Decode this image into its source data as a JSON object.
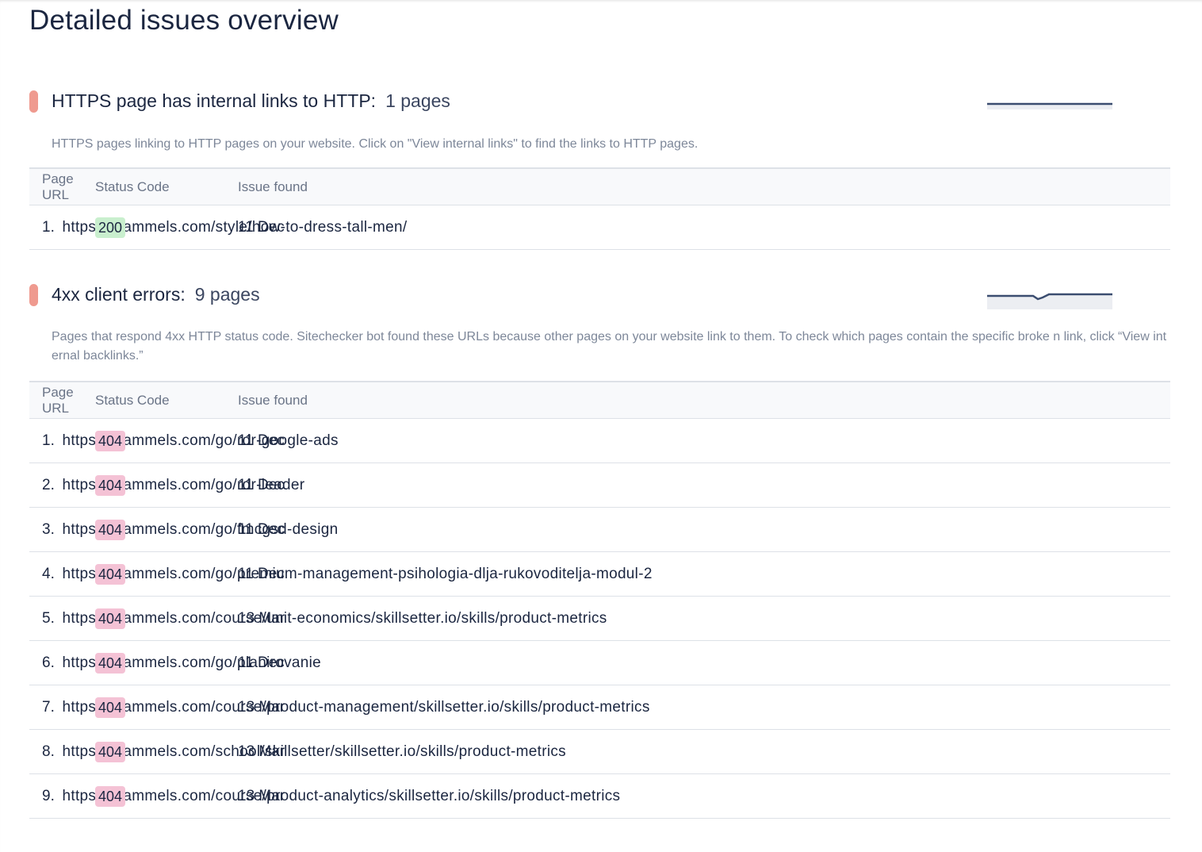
{
  "page": {
    "title": "Detailed issues overview"
  },
  "colors": {
    "marker": "#ef9a8f",
    "badge_ok": "#c9efce",
    "badge_error": "#f4c2d5",
    "sparkline": "#3b4d70"
  },
  "sections": [
    {
      "title": "HTTPS page has internal links to HTTP:",
      "count": "1 pages",
      "description": "HTTPS pages linking to HTTP pages on your website. Click on \"View internal links\" to find the links to HTTP pages.",
      "columns": [
        "Page URL",
        "Status Code",
        "Issue found"
      ],
      "rows": [
        {
          "num": "1.",
          "url": "https://brammels.com/style/how-to-dress-tall-men/",
          "status": "200",
          "date": "11 Dec"
        }
      ]
    },
    {
      "title": "4xx client errors:",
      "count": "9 pages",
      "description": "Pages that respond 4xx HTTP status code. Sitechecker bot found these URLs because other pages on your website link to them. To check which pages contain the specific broke n link, click “View internal backlinks.”",
      "columns": [
        "Page URL",
        "Status Code",
        "Issue found"
      ],
      "rows": [
        {
          "num": "1.",
          "url": "https://brammels.com/go/rdr-google-ads",
          "status": "404",
          "date": "11 Dec"
        },
        {
          "num": "2.",
          "url": "https://brammels.com/go/rdr-leader",
          "status": "404",
          "date": "11 Dec"
        },
        {
          "num": "3.",
          "url": "https://brammels.com/go/fmcgsd-design",
          "status": "404",
          "date": "11 Dec"
        },
        {
          "num": "4.",
          "url": "https://brammels.com/go/premium-management-psihologia-dlja-rukovoditelja-modul-2",
          "status": "404",
          "date": "11 Dec"
        },
        {
          "num": "5.",
          "url": "https://brammels.com/course/unit-economics/skillsetter.io/skills/product-metrics",
          "status": "404",
          "date": "13 Mar"
        },
        {
          "num": "6.",
          "url": "https://brammels.com/go/planirovanie",
          "status": "404",
          "date": "11 Dec"
        },
        {
          "num": "7.",
          "url": "https://brammels.com/course/product-management/skillsetter.io/skills/product-metrics",
          "status": "404",
          "date": "13 Mar"
        },
        {
          "num": "8.",
          "url": "https://brammels.com/school/skillsetter/skillsetter.io/skills/product-metrics",
          "status": "404",
          "date": "13 Mar"
        },
        {
          "num": "9.",
          "url": "https://brammels.com/course/product-analytics/skillsetter.io/skills/product-metrics",
          "status": "404",
          "date": "13 Mar"
        }
      ]
    }
  ]
}
